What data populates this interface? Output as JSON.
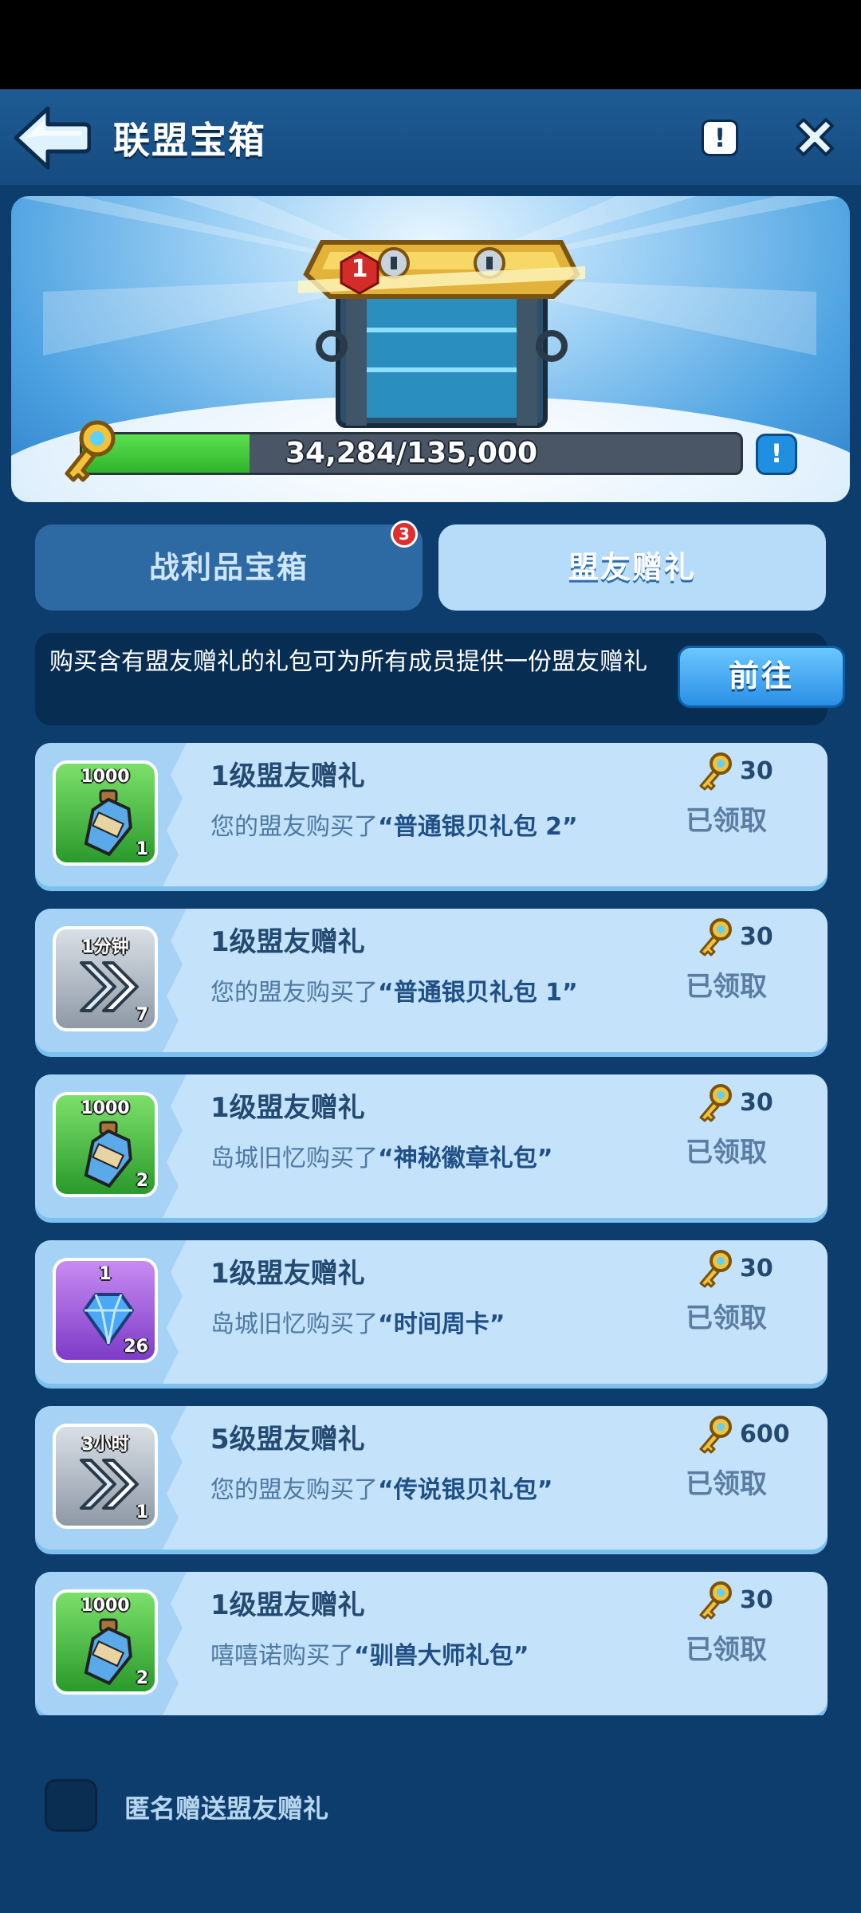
{
  "header": {
    "title": "联盟宝箱",
    "info_label": "!"
  },
  "banner": {
    "chest_badge": "1",
    "progress_text": "34,284/135,000",
    "progress_fraction": 0.254,
    "info_label": "!"
  },
  "tabs": [
    {
      "label": "战利品宝箱",
      "badge": "3"
    },
    {
      "label": "盟友赠礼"
    }
  ],
  "notice": {
    "text": "购买含有盟友赠礼的礼包可为所有成员提供一份盟友赠礼",
    "button": "前往"
  },
  "gifts": [
    {
      "title": "1级盟友赠礼",
      "buyer": "您的盟友购买了",
      "pack": "“普通银贝礼包 2”",
      "keys": "30",
      "status": "已领取",
      "icon": "exp-potion-icon",
      "icon_top": "1000",
      "icon_count": "1"
    },
    {
      "title": "1级盟友赠礼",
      "buyer": "您的盟友购买了",
      "pack": "“普通银贝礼包 1”",
      "keys": "30",
      "status": "已领取",
      "icon": "speedup-icon",
      "icon_top": "1分钟",
      "icon_count": "7"
    },
    {
      "title": "1级盟友赠礼",
      "buyer": "岛城旧忆购买了",
      "pack": "“神秘徽章礼包”",
      "keys": "30",
      "status": "已领取",
      "icon": "exp-potion-icon",
      "icon_top": "1000",
      "icon_count": "2"
    },
    {
      "title": "1级盟友赠礼",
      "buyer": "岛城旧忆购买了",
      "pack": "“时间周卡”",
      "keys": "30",
      "status": "已领取",
      "icon": "diamond-icon",
      "icon_top": "1",
      "icon_count": "26"
    },
    {
      "title": "5级盟友赠礼",
      "buyer": "您的盟友购买了",
      "pack": "“传说银贝礼包”",
      "keys": "600",
      "status": "已领取",
      "icon": "speedup-icon",
      "icon_top": "3小时",
      "icon_count": "1"
    },
    {
      "title": "1级盟友赠礼",
      "buyer": "嘻嘻诺购买了",
      "pack": "“驯兽大师礼包”",
      "keys": "30",
      "status": "已领取",
      "icon": "exp-potion-icon",
      "icon_top": "1000",
      "icon_count": "2"
    }
  ],
  "anonymous": {
    "label": "匿名赠送盟友赠礼"
  }
}
